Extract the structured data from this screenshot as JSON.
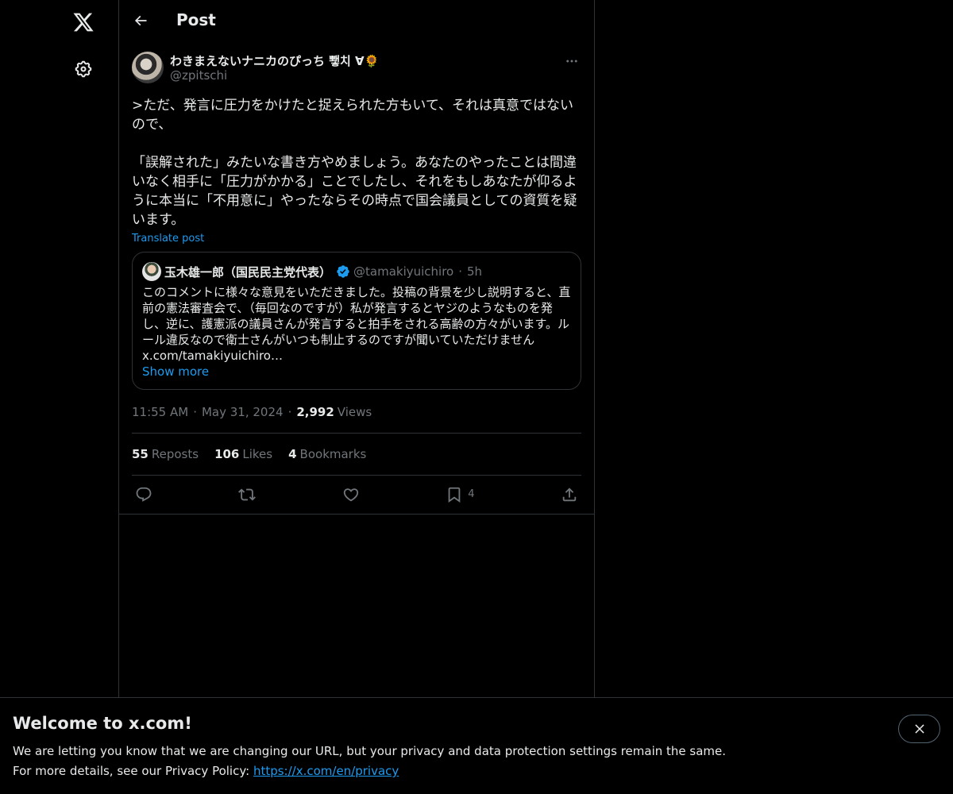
{
  "header": {
    "title": "Post",
    "back_label": "Back"
  },
  "post": {
    "author_name": "わきまえないナニカのぴっち 뾓치 ∀🌻",
    "author_handle": "@zpitschi",
    "text": ">ただ、発言に圧力をかけたと捉えられた方もいて、それは真意ではないので、\n\n「誤解された」みたいな書き方やめましょう。あなたのやったことは間違いなく相手に「圧力がかかる」ことでしたし、それをもしあなたが仰るように本当に「不用意に」やったならその時点で国会議員としての資質を疑います。",
    "translate_label": "Translate post",
    "time": "11:55 AM",
    "date": "May 31, 2024",
    "views_count": "2,992",
    "views_label": "Views",
    "stats": {
      "reposts_count": "55",
      "reposts_label": "Reposts",
      "likes_count": "106",
      "likes_label": "Likes",
      "bookmarks_count": "4",
      "bookmarks_label": "Bookmarks"
    },
    "actions": {
      "bookmark_count": "4"
    }
  },
  "quote": {
    "author_name": "玉木雄一郎（国民民主党代表）",
    "author_handle": "@tamakiyuichiro",
    "time": "5h",
    "text": "このコメントに様々な意見をいただきました。投稿の背景を少し説明すると、直前の憲法審査会で、（毎回なのですが）私が発言するとヤジのようなものを発し、逆に、護憲派の議員さんが発言すると拍手をされる高齢の方々がいます。ルール違反なので衛士さんがいつも制止するのですが聞いていただけません\nx.com/tamakiyuichiro…",
    "show_more": "Show more"
  },
  "banner": {
    "title": "Welcome to x.com!",
    "line1": "We are letting you know that we are changing our URL, but your privacy and data protection settings remain the same.",
    "line2_prefix": "For more details, see our Privacy Policy: ",
    "link": "https://x.com/en/privacy"
  },
  "icons": {
    "logo": "x-logo-icon",
    "settings": "gear-icon",
    "back": "arrow-left-icon",
    "more": "more-horizontal-icon",
    "reply": "reply-icon",
    "repost": "repost-icon",
    "like": "heart-icon",
    "bookmark": "bookmark-icon",
    "share": "share-icon",
    "close": "close-icon",
    "verified": "verified-badge-icon"
  },
  "colors": {
    "accent": "#1d9bf0",
    "background": "#000000",
    "text": "#e7e9ea",
    "muted": "#71767b",
    "border": "#2f3336"
  }
}
